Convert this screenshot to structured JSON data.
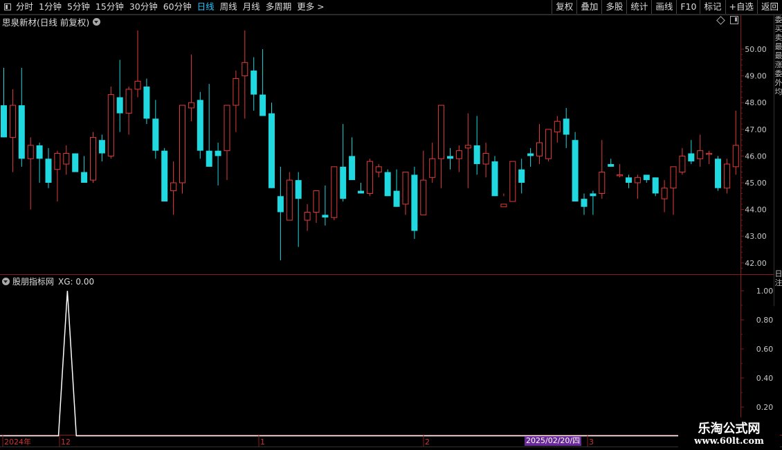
{
  "toolbar": {
    "periods": [
      "分时",
      "1分钟",
      "5分钟",
      "15分钟",
      "30分钟",
      "60分钟",
      "日线",
      "周线",
      "月线",
      "多周期",
      "更多 >"
    ],
    "active_period": "日线",
    "right": [
      "复权",
      "叠加",
      "多股",
      "统计",
      "画线",
      "F10",
      "标记",
      "+自选",
      "返回"
    ]
  },
  "main_chart": {
    "title": "思泉新材(日线 前复权)",
    "y_ticks": [
      "50.00",
      "49.00",
      "48.00",
      "47.00",
      "46.00",
      "45.00",
      "44.00",
      "43.00",
      "42.00"
    ]
  },
  "indicator": {
    "title": "股朋指标网",
    "value_label": "XG: 0.00",
    "y_ticks": [
      "1.00",
      "0.80",
      "0.60",
      "0.40",
      "0.20"
    ]
  },
  "date_axis": {
    "labels": [
      "2024年",
      "12",
      "1",
      "2",
      "3"
    ],
    "cursor_date": "2025/02/20/四"
  },
  "side_strip": "委买卖最最涨委外均",
  "side_strip_lower": "日注",
  "watermark": {
    "line1": "乐淘公式网",
    "line2": "www.60lt.com"
  },
  "colors": {
    "up": "#e23b3b",
    "down": "#1fd8e0",
    "grid": "#8b1a1a",
    "active": "#1ec8ff"
  },
  "chart_data": {
    "type": "candlestick",
    "ylim": [
      41.6,
      51.2
    ],
    "candles": [
      [
        47.9,
        49.3,
        46.7,
        46.7
      ],
      [
        46.7,
        48.5,
        45.4,
        47.9
      ],
      [
        47.9,
        49.3,
        45.6,
        45.9
      ],
      [
        45.9,
        46.7,
        44.0,
        46.4
      ],
      [
        46.4,
        46.5,
        45.0,
        45.9
      ],
      [
        45.9,
        46.3,
        44.8,
        45.0
      ],
      [
        45.5,
        46.2,
        44.3,
        46.1
      ],
      [
        45.7,
        46.4,
        45.3,
        46.1
      ],
      [
        46.1,
        46.1,
        45.5,
        45.4
      ],
      [
        45.4,
        46.0,
        45.2,
        45.0
      ],
      [
        45.1,
        46.9,
        45.0,
        46.7
      ],
      [
        46.6,
        46.8,
        45.8,
        46.1
      ],
      [
        46.0,
        48.6,
        45.9,
        48.3
      ],
      [
        48.2,
        49.6,
        46.9,
        47.6
      ],
      [
        47.6,
        48.6,
        46.8,
        48.5
      ],
      [
        48.5,
        50.7,
        48.2,
        48.8
      ],
      [
        48.6,
        48.9,
        47.2,
        47.4
      ],
      [
        47.4,
        48.1,
        45.9,
        46.2
      ],
      [
        46.2,
        46.3,
        44.6,
        44.3
      ],
      [
        44.7,
        45.8,
        43.8,
        45.0
      ],
      [
        45.0,
        47.9,
        44.6,
        47.9
      ],
      [
        47.8,
        49.8,
        47.3,
        48.0
      ],
      [
        48.1,
        48.4,
        45.9,
        46.2
      ],
      [
        46.2,
        48.7,
        45.6,
        45.6
      ],
      [
        46.2,
        46.5,
        44.9,
        46.0
      ],
      [
        46.2,
        47.6,
        45.1,
        47.9
      ],
      [
        47.9,
        49.2,
        46.9,
        48.9
      ],
      [
        49.0,
        50.7,
        47.4,
        49.5
      ],
      [
        49.2,
        49.7,
        47.7,
        48.3
      ],
      [
        48.3,
        50.0,
        47.5,
        47.5
      ],
      [
        47.6,
        48.0,
        44.8,
        44.8
      ],
      [
        44.5,
        45.6,
        42.1,
        43.9
      ],
      [
        43.6,
        45.4,
        43.6,
        45.1
      ],
      [
        45.1,
        45.4,
        42.6,
        44.4
      ],
      [
        43.6,
        44.2,
        43.2,
        43.9
      ],
      [
        43.9,
        44.4,
        43.5,
        44.7
      ],
      [
        43.8,
        44.9,
        43.4,
        43.7
      ],
      [
        43.7,
        45.6,
        43.6,
        45.6
      ],
      [
        45.6,
        47.2,
        44.3,
        44.4
      ],
      [
        46.0,
        46.7,
        45.3,
        45.1
      ],
      [
        44.7,
        45.0,
        44.6,
        44.6
      ],
      [
        44.6,
        45.9,
        44.5,
        45.8
      ],
      [
        45.4,
        45.7,
        45.2,
        45.6
      ],
      [
        45.4,
        45.5,
        44.5,
        44.5
      ],
      [
        44.7,
        45.5,
        44.1,
        44.1
      ],
      [
        44.2,
        45.0,
        43.8,
        45.4
      ],
      [
        45.3,
        45.6,
        42.9,
        43.2
      ],
      [
        43.8,
        46.2,
        43.8,
        45.1
      ],
      [
        45.2,
        46.5,
        45.0,
        45.9
      ],
      [
        45.9,
        47.7,
        44.8,
        47.9
      ],
      [
        46.0,
        46.3,
        45.5,
        45.9
      ],
      [
        45.9,
        46.4,
        45.4,
        46.2
      ],
      [
        46.3,
        47.6,
        44.8,
        46.4
      ],
      [
        46.4,
        47.5,
        45.3,
        45.7
      ],
      [
        45.7,
        46.5,
        45.2,
        46.1
      ],
      [
        45.8,
        46.0,
        44.6,
        44.5
      ],
      [
        44.1,
        44.6,
        44.5,
        44.2
      ],
      [
        44.3,
        45.3,
        44.5,
        45.8
      ],
      [
        45.5,
        45.9,
        44.6,
        45.0
      ],
      [
        46.1,
        46.3,
        45.6,
        46.0
      ],
      [
        46.0,
        47.2,
        45.7,
        46.5
      ],
      [
        45.9,
        47.0,
        45.8,
        47.0
      ],
      [
        46.9,
        47.5,
        46.5,
        47.3
      ],
      [
        47.4,
        47.8,
        46.3,
        46.8
      ],
      [
        46.6,
        46.9,
        44.3,
        44.3
      ],
      [
        44.4,
        44.6,
        43.8,
        44.1
      ],
      [
        44.6,
        44.7,
        43.8,
        44.5
      ],
      [
        44.6,
        46.6,
        44.4,
        45.4
      ],
      [
        45.7,
        45.9,
        45.6,
        45.6
      ],
      [
        45.3,
        45.7,
        45.2,
        45.3
      ],
      [
        45.2,
        45.3,
        44.8,
        45.0
      ],
      [
        45.0,
        45.3,
        44.4,
        45.2
      ],
      [
        45.3,
        45.3,
        45.0,
        45.1
      ],
      [
        45.2,
        45.2,
        44.5,
        44.6
      ],
      [
        44.4,
        45.1,
        43.9,
        44.8
      ],
      [
        44.8,
        45.6,
        43.8,
        45.6
      ],
      [
        45.4,
        46.3,
        45.3,
        46.0
      ],
      [
        46.1,
        46.6,
        45.7,
        45.8
      ],
      [
        45.9,
        46.8,
        45.6,
        46.2
      ],
      [
        46.1,
        46.2,
        45.7,
        46.1
      ],
      [
        45.9,
        46.0,
        44.7,
        44.8
      ],
      [
        44.8,
        45.9,
        44.6,
        45.7
      ],
      [
        45.6,
        47.7,
        45.3,
        46.4
      ]
    ],
    "indicator_series": {
      "name": "XG",
      "ylim": [
        0,
        1.05
      ],
      "spike_index": 6,
      "spike_value": 1.0
    }
  }
}
